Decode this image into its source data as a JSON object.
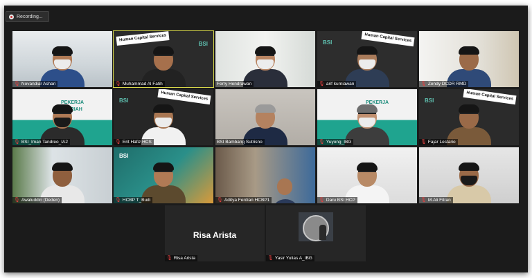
{
  "recording": {
    "label": "Recording..."
  },
  "colors": {
    "window_bg": "#1b1b1b",
    "active_speaker": "#d8d84a",
    "mic_muted": "#e34040"
  },
  "participants": [
    {
      "name": "Novandiar Ashari"
    },
    {
      "name": "Muhammad Al Fatih"
    },
    {
      "name": "Ferry Hendrawan"
    },
    {
      "name": "arif kurniawan"
    },
    {
      "name": "Zendy DCDR RMD"
    },
    {
      "name": "BSI_Iman Tandreo_IA2"
    },
    {
      "name": "Erit Hafiz HCS"
    },
    {
      "name": "BSI Bambang Sutrisno"
    },
    {
      "name": "Yuyong_IBG"
    },
    {
      "name": "Fajar Lestario"
    },
    {
      "name": "Awaluddin (Deden)"
    },
    {
      "name": "HCBP T_Budi"
    },
    {
      "name": "Aditya Ferdian HCBP1"
    },
    {
      "name": "Daru BSI HCP"
    },
    {
      "name": "M.Ali Fitran"
    },
    {
      "name": "Risa Arista",
      "display_text": "Risa Arista"
    },
    {
      "name": "Yasir Yulias A_IBG"
    }
  ],
  "backgrounds": {
    "bsi": "BSI",
    "hcs_sign": "Human Capital Services",
    "pekerja": "PEKERJA",
    "syariah": "SYARIAH"
  }
}
